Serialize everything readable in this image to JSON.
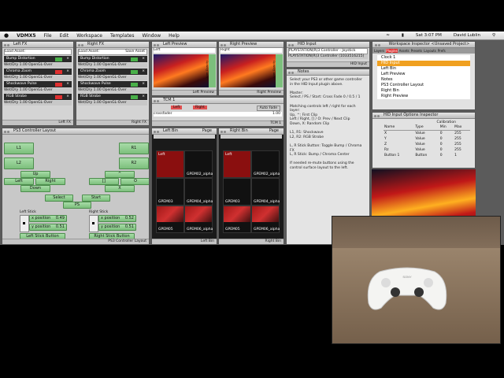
{
  "menubar": {
    "app": "VDMX5",
    "items": [
      "File",
      "Edit",
      "Workspace",
      "Templates",
      "Window",
      "Help"
    ],
    "clock": "Sat 3:07 PM",
    "user": "David Lublin"
  },
  "left_fx": {
    "title": "Left FX",
    "asset_select": "Load Asset:",
    "clear_label": "Clear",
    "effects": [
      {
        "name": "Bump Distortion",
        "state": "On"
      },
      {
        "name": "Chroma Zoom",
        "state": "On"
      },
      {
        "name": "Shockwave Pulse",
        "state": "On"
      },
      {
        "name": "RGB Strobe",
        "state": "On"
      }
    ],
    "wetdry_label": "Wet/Dry",
    "wetdry_value": "1.00",
    "blend_mode": "OpenGL-Over",
    "footer": "Left FX"
  },
  "right_fx": {
    "title": "Right FX",
    "asset_select": "Load Asset:",
    "save_label": "Save Asset",
    "effects": [
      {
        "name": "Bump Distortion",
        "state": "On"
      },
      {
        "name": "Chroma Zoom",
        "state": "On"
      },
      {
        "name": "Shockwave Pulse",
        "state": "On"
      },
      {
        "name": "RGB Strobe",
        "state": "On"
      }
    ],
    "wetdry_label": "Wet/Dry",
    "wetdry_value": "1.00",
    "blend_mode": "OpenGL-Over",
    "footer": "Right FX"
  },
  "left_preview": {
    "title": "Left Preview",
    "selector": "Left",
    "footer": "Left Preview",
    "opacity_label": "Layer Opacity"
  },
  "right_preview": {
    "title": "Right Preview",
    "selector": "Right",
    "footer": "Right Preview",
    "opacity_label": "Layer Opacity"
  },
  "tcm": {
    "title": "TCM 1",
    "crossfader_label": "crossfader",
    "crossfader_value": "1.00",
    "left_label": "Left",
    "right_label": "Right",
    "auto_fade": "Auto Fade",
    "footer": "TCM 1"
  },
  "ps3": {
    "title": "PS3 Controller Layout",
    "L1": "L1",
    "L2": "L2",
    "R1": "R1",
    "R2": "R2",
    "up": "Up",
    "left": "Left",
    "right": "Right",
    "down": "Down",
    "triangle": "^",
    "square": "[]",
    "circle": "O",
    "cross": "X",
    "select": "Select",
    "start": "Start",
    "ps": "PS",
    "left_stick": "Left Stick",
    "right_stick": "Right Stick",
    "lx_label": "x position",
    "lx_value": "0.49",
    "ly_label": "y position",
    "ly_value": "0.51",
    "rx_label": "x position",
    "rx_value": "0.52",
    "ry_label": "y position",
    "ry_value": "0.51",
    "left_stick_button": "Left Stick Button",
    "right_stick_button": "Right Stick Button",
    "footer": "PS3 Controller Layout"
  },
  "left_bin": {
    "title": "Left Bin",
    "page": "Page",
    "clips": [
      "Left",
      "GPEM02_alpha",
      "GPEM03",
      "GPEM04_alpha",
      "GPEM05",
      "GPEM06_alpha"
    ],
    "footer": "Left Bin"
  },
  "right_bin": {
    "title": "Right Bin",
    "page": "Page",
    "clips": [
      "Left",
      "GPEM02_alpha",
      "GPEM03",
      "GPEM04_alpha",
      "GPEM05",
      "GPEM06_alpha"
    ],
    "footer": "Right Bin"
  },
  "hid_input": {
    "title": "HID Input",
    "device": "PLAYSTATION(R)3 Controller - Joystick",
    "device_line": "PLAYSTATION(R)3 Controller (1033516215)",
    "footer": "HID Input"
  },
  "notes": {
    "title": "Notes",
    "lines": [
      "Select your PS3 or other game controller in the HID Input plugin above.",
      "",
      "Master:",
      "Select / PS / Start: Cross Fade 0 / 0.5 / 1",
      "",
      "Matching controls left / right for each layer:",
      "Up, ^: First Clip",
      "Left / Right, [] / O: Prev / Next Clip",
      "Down, X: Random Clip",
      "",
      "L1, R1: Shockwave",
      "L2, R2: RGB Strobe",
      "",
      "L, R Stick Button: Toggle Bump / Chroma FX",
      "L, R Stick: Bump / Chroma Center",
      "",
      "If needed re-mute buttons using the control surface layout to the left."
    ]
  },
  "workspace_inspector": {
    "title": "Workspace Inspector",
    "project": "<Unsaved Project>",
    "tabs": [
      "Layers",
      "Plugins",
      "Assets",
      "Presets",
      "Layouts",
      "Prefs"
    ],
    "items": [
      "Clock 1",
      "HID Input",
      "Left Bin",
      "Left Preview",
      "Notes",
      "PS3 Controller Layout",
      "Right Bin",
      "Right Preview"
    ],
    "selected": "HID Input"
  },
  "hid_options": {
    "title": "HID Input Options Inspector",
    "columns": [
      "Name",
      "Type",
      "Min",
      "Max"
    ],
    "calibration": "Calibration",
    "rows": [
      [
        "X",
        "Value",
        "0",
        "255"
      ],
      [
        "Y",
        "Value",
        "0",
        "255"
      ],
      [
        "Z",
        "Value",
        "0",
        "255"
      ],
      [
        "Rz",
        "Value",
        "0",
        "255"
      ],
      [
        "Button 1",
        "Button",
        "0",
        "1"
      ]
    ]
  },
  "colors": {
    "accent": "#f0a020",
    "on": "#49b049",
    "off": "#e03030",
    "menubar": "#e0e0e0"
  }
}
